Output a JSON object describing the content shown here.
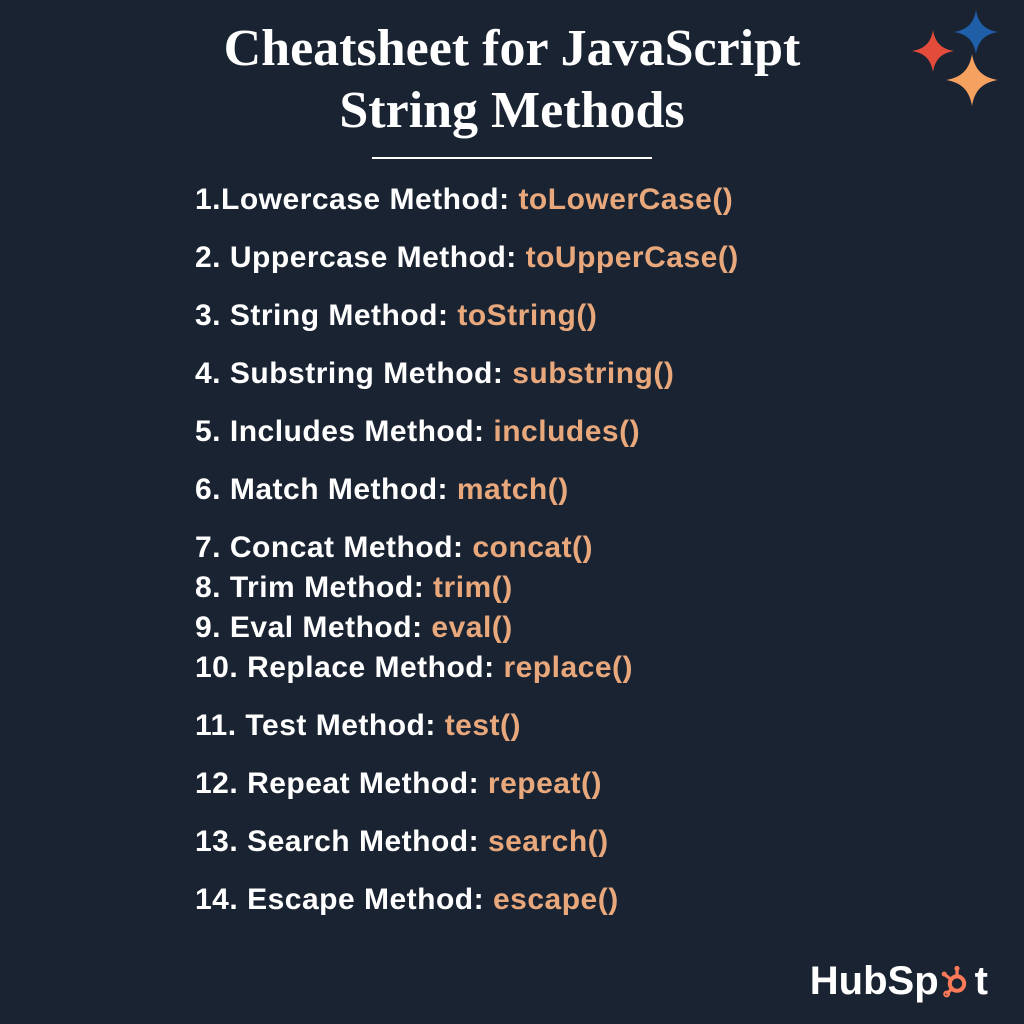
{
  "title_line1": "Cheatsheet for JavaScript",
  "title_line2": "String Methods",
  "items": [
    {
      "prefix": "1.",
      "label": "Lowercase Method:",
      "method": "toLowerCase()"
    },
    {
      "prefix": "2.",
      "label": "Uppercase Method:",
      "method": "toUpperCase()"
    },
    {
      "prefix": "3.",
      "label": "String Method:",
      "method": "toString()"
    },
    {
      "prefix": "4.",
      "label": "Substring Method:",
      "method": "substring()"
    },
    {
      "prefix": "5.",
      "label": "Includes Method:",
      "method": "includes()"
    },
    {
      "prefix": "6.",
      "label": "Match Method:",
      "method": "match()"
    },
    {
      "prefix": "7.",
      "label": "Concat Method:",
      "method": "concat()"
    },
    {
      "prefix": "8.",
      "label": "Trim Method:",
      "method": "trim()"
    },
    {
      "prefix": "9.",
      "label": "Eval Method:",
      "method": "eval()"
    },
    {
      "prefix": "10.",
      "label": "Replace Method:",
      "method": "replace()"
    },
    {
      "prefix": "11.",
      "label": "Test Method:",
      "method": "test()"
    },
    {
      "prefix": "12.",
      "label": "Repeat Method:",
      "method": "repeat()"
    },
    {
      "prefix": "13.",
      "label": "Search Method:",
      "method": "search()"
    },
    {
      "prefix": "14.",
      "label": "Escape Method:",
      "method": "escape()"
    }
  ],
  "logo_text_left": "HubSp",
  "logo_text_right": "t",
  "colors": {
    "background": "#1a2332",
    "text": "#ffffff",
    "accent": "#e8a87c",
    "sparkle_orange": "#f5a15f",
    "sparkle_red": "#e34b3a",
    "sparkle_blue": "#1f5fa8",
    "logo_orange": "#ff7a59"
  }
}
